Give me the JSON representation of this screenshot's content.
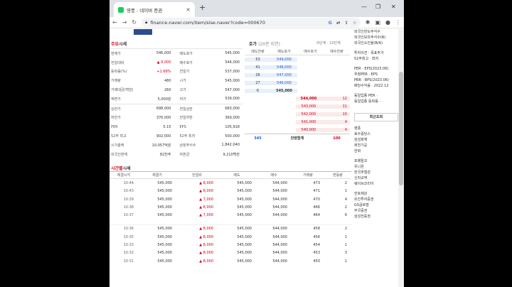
{
  "browser": {
    "tab_title": "영풍 : 네이버 증권",
    "new_tab": "+",
    "url": "finance.naver.com/item/sise.naver?code=000670",
    "minimize": "—",
    "restore": "❐",
    "close": "✕"
  },
  "quote_section": {
    "title_prefix": "주요",
    "title_suffix": "시세",
    "groups": [
      [
        {
          "l1": "현재가",
          "v1": "546,000",
          "c1": "",
          "l2": "매도호가",
          "v2": "545,000"
        },
        {
          "l1": "전일대비",
          "v1": "▲ 9,000",
          "c1": "red",
          "l2": "매수호가",
          "v2": "544,000"
        },
        {
          "l1": "등락률(%)",
          "v1": "+1.68%",
          "c1": "red",
          "l2": "전일가",
          "v2": "537,000"
        },
        {
          "l1": "거래량",
          "v1": "480",
          "c1": "",
          "l2": "시가",
          "v2": "545,000"
        },
        {
          "l1": "거래대금(백만)",
          "v1": "260",
          "c1": "",
          "l2": "고가",
          "v2": "547,000"
        },
        {
          "l1": "액면가",
          "v1": "5,000원",
          "c1": "",
          "l2": "저가",
          "v2": "539,000"
        }
      ],
      [
        {
          "l1": "상한가",
          "v1": "698,000",
          "c1": "",
          "l2": "전일상한",
          "v2": "683,000"
        },
        {
          "l1": "하한가",
          "v1": "376,000",
          "c1": "",
          "l2": "전일하한",
          "v2": "369,000"
        },
        {
          "l1": "PER",
          "v1": "5.15",
          "c1": "",
          "l2": "EPS",
          "v2": "105,918"
        },
        {
          "l1": "52주 최고",
          "v1": "902,000",
          "c1": "",
          "l2": "52주 최저",
          "v2": "500,000"
        },
        {
          "l1": "시가총액",
          "v1": "10,057억원",
          "c1": "",
          "l2": "상장주식수",
          "v2": "1,842,040"
        },
        {
          "l1": "외국인현재",
          "v1": "82천주",
          "c1": "",
          "l2": "자본금",
          "v2": "9,210백만"
        }
      ]
    ]
  },
  "orderbook": {
    "title": "호가",
    "subtitle": "(20분 지연)",
    "link": "›5단계 · 10단계",
    "headers": [
      "매도잔량",
      "매도호가",
      "매수호가",
      "매수잔량"
    ],
    "asks": [
      {
        "qty": "53",
        "price": "549,000"
      },
      {
        "qty": "41",
        "price": "548,000"
      },
      {
        "qty": "26",
        "price": "547,000"
      },
      {
        "qty": "27",
        "price": "546,000"
      },
      {
        "qty": "6",
        "price": "545,000"
      }
    ],
    "bids": [
      {
        "price": "544,000",
        "qty": "12"
      },
      {
        "price": "543,000",
        "qty": "11"
      },
      {
        "price": "542,000",
        "qty": "10"
      },
      {
        "price": "541,000",
        "qty": "4"
      },
      {
        "price": "540,000",
        "qty": "4"
      }
    ],
    "footer": {
      "ask_total": "345",
      "label": "잔량합계",
      "bid_total": "100"
    }
  },
  "time_section": {
    "title_prefix": "시간별",
    "title_suffix": "시세",
    "headers": [
      "체결시각",
      "체결가",
      "전일비",
      "매도",
      "매수",
      "거래량",
      "변동량"
    ],
    "rows_a": [
      [
        "10:44",
        "545,000",
        "▲ 8,000",
        "545,000",
        "544,000",
        "473",
        "2"
      ],
      [
        "10:43",
        "545,000",
        "▲ 8,000",
        "545,000",
        "544,000",
        "471",
        "1"
      ],
      [
        "10:39",
        "545,000",
        "▲ 7,000",
        "545,000",
        "544,000",
        "470",
        "4"
      ],
      [
        "10:38",
        "545,000",
        "▲ 8,000",
        "545,000",
        "544,000",
        "466",
        "2"
      ],
      [
        "10:37",
        "545,000",
        "▲ 7,000",
        "545,000",
        "544,000",
        "464",
        "6"
      ]
    ],
    "rows_b": [
      [
        "10:36",
        "545,000",
        "▲ 8,000",
        "545,000",
        "544,000",
        "458",
        "2"
      ],
      [
        "10:35",
        "545,000",
        "▲ 8,000",
        "545,000",
        "544,000",
        "456",
        "1"
      ],
      [
        "10:33",
        "545,000",
        "▲ 8,000",
        "545,000",
        "544,000",
        "454",
        "1"
      ],
      [
        "10:32",
        "545,000",
        "▲ 8,000",
        "545,000",
        "544,000",
        "453",
        "3"
      ],
      [
        "10:31",
        "545,000",
        "▲ 8,000",
        "545,000",
        "544,000",
        "450",
        "1"
      ]
    ]
  },
  "sidebar": {
    "top_lines": [
      "외국인한도주식수",
      "외국인보유주식수(B)",
      "외국인소진율(B/A)"
    ],
    "mid_lines": [
      "투자의견 · 목표주가",
      "52주최고 · 최저"
    ],
    "per_lines": [
      "PER · EPS(2023.06)",
      "추정PER · EPS",
      "PBR · BPS(2023.06)",
      "배당수익률 · 2022.12"
    ],
    "peer_lines": [
      "동일업종 PER ·",
      "동일업종 등락률 ·"
    ],
    "recent_btn": "최근조회",
    "recent_a": [
      "영풍",
      "효수증당스",
      "삼성화재",
      "화천기공",
      "한화"
    ],
    "recent_b": [
      "포메탈코",
      "유니온",
      "한국주철관",
      "신라교역",
      "웨이브코리아"
    ],
    "recent_c": [
      "한호제강",
      "유진투자증권",
      "GS글로벌",
      "부국증권",
      "삼성전증권"
    ]
  }
}
